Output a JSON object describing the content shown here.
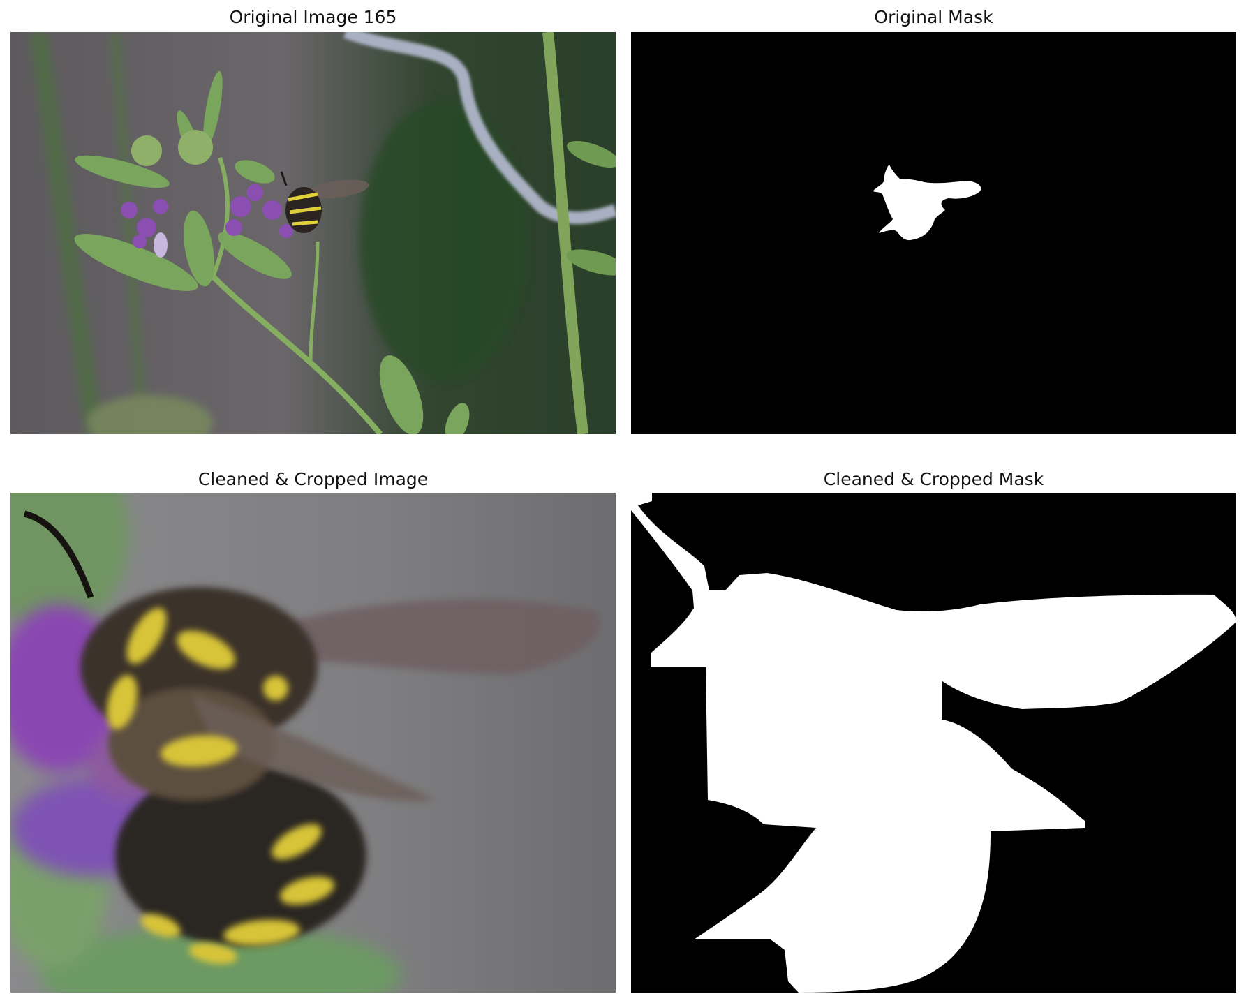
{
  "panels": [
    {
      "id": "original-image",
      "title": "Original Image 165"
    },
    {
      "id": "original-mask",
      "title": "Original Mask"
    },
    {
      "id": "cleaned-cropped-image",
      "title": "Cleaned & Cropped Image"
    },
    {
      "id": "cleaned-cropped-mask",
      "title": "Cleaned & Cropped Mask"
    }
  ],
  "colors": {
    "background": "#ffffff",
    "mask_bg": "#000000",
    "mask_fg": "#ffffff",
    "foliage": "#6fa35a",
    "petal": "#8a4fb0",
    "bee_yellow": "#d8c437",
    "fence_gray": "#7c7b7d"
  }
}
